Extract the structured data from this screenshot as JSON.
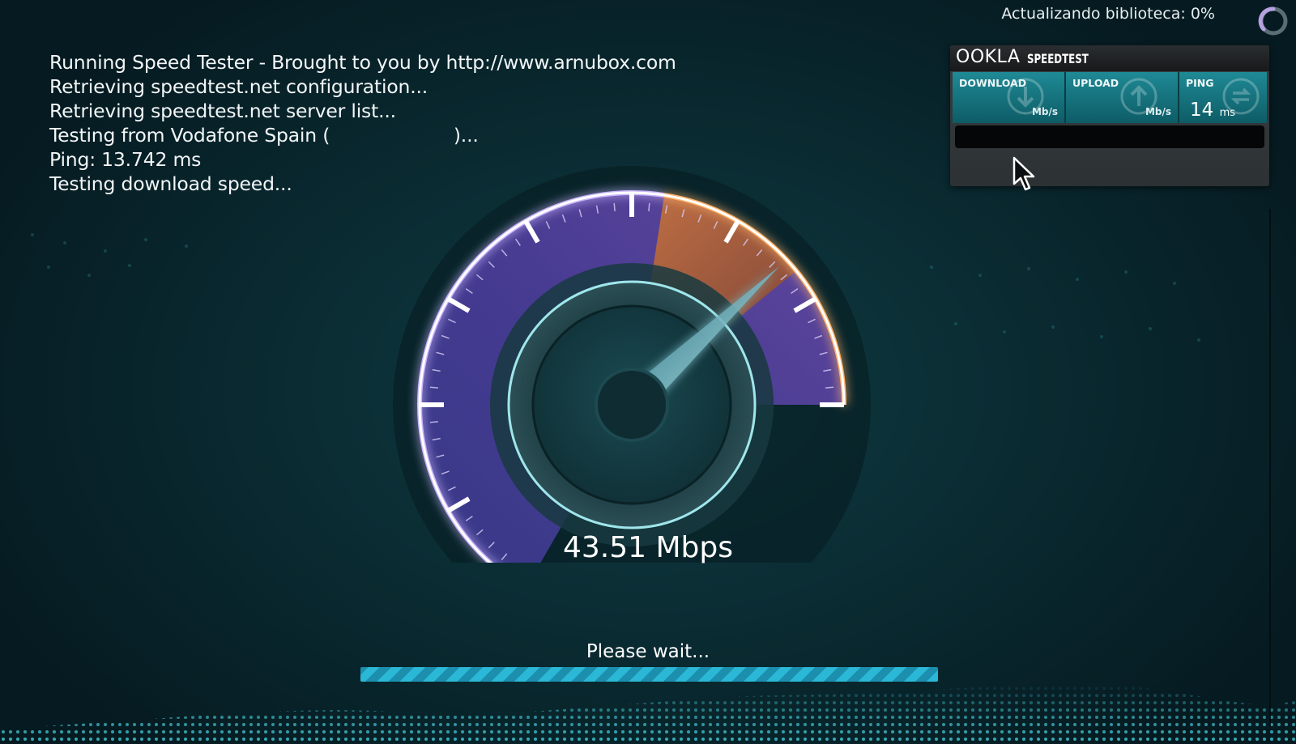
{
  "status_bar": {
    "label": "Actualizando biblioteca:",
    "percent": "0%"
  },
  "log_lines": [
    "Running Speed Tester - Brought to you by http://www.arnubox.com",
    "Retrieving speedtest.net configuration...",
    "Retrieving speedtest.net server list...",
    "Testing from Vodafone Spain (                     )...",
    "Ping: 13.742 ms",
    "Testing download speed..."
  ],
  "widget": {
    "logo": "OOKLA",
    "product": "SPEEDTEST",
    "download": {
      "label": "DOWNLOAD",
      "value": "",
      "unit": "Mb/s",
      "icon": "download-arrow-icon"
    },
    "upload": {
      "label": "UPLOAD",
      "value": "",
      "unit": "Mb/s",
      "icon": "upload-arrow-icon"
    },
    "ping": {
      "label": "PING",
      "value": "14",
      "unit": "ms",
      "icon": "ping-icon"
    }
  },
  "gauge": {
    "reading": "43.51 Mbps",
    "value": 43.51,
    "needle_fraction": 0.82
  },
  "footer": {
    "message": "Please wait...",
    "progress": 1.0
  },
  "colors": {
    "background": "#0b2d34",
    "gauge_purple": "#5b3f9e",
    "gauge_orange": "#e08a3c",
    "needle": "#a9ecf6",
    "accent_teal": "#2bb7d6"
  }
}
